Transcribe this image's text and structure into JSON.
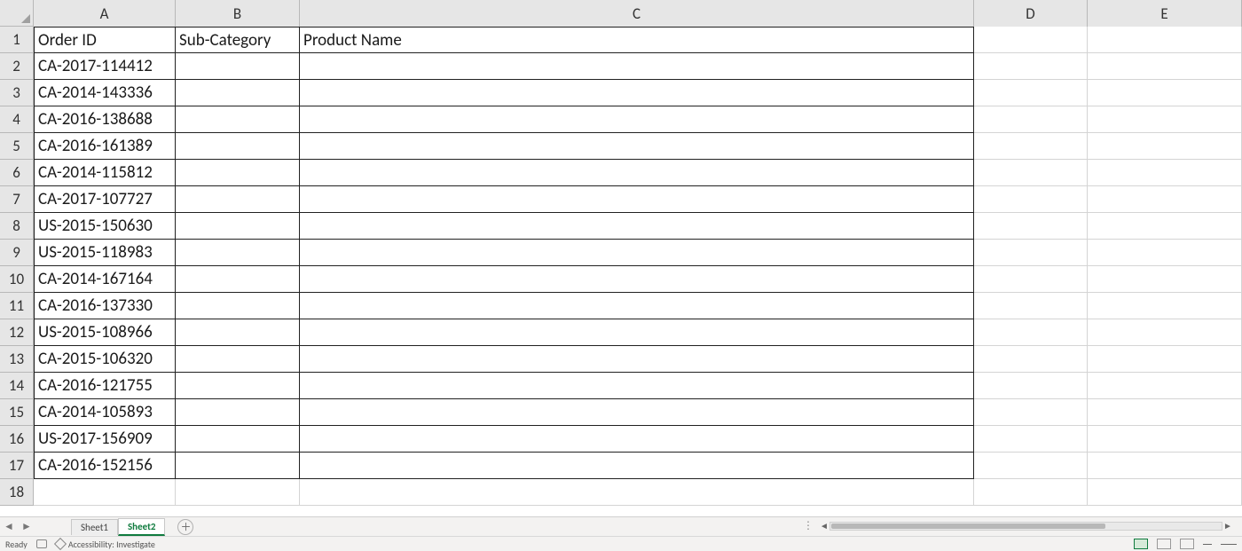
{
  "columns": [
    "A",
    "B",
    "C",
    "D",
    "E"
  ],
  "header_cells": {
    "A": "Order ID",
    "B": "Sub-Category",
    "C": "Product Name"
  },
  "data_rows": [
    "CA-2017-114412",
    "CA-2014-143336",
    "CA-2016-138688",
    "CA-2016-161389",
    "CA-2014-115812",
    "CA-2017-107727",
    "US-2015-150630",
    "US-2015-118983",
    "CA-2014-167164",
    "CA-2016-137330",
    "US-2015-108966",
    "CA-2015-106320",
    "CA-2016-121755",
    "CA-2014-105893",
    "US-2017-156909",
    "CA-2016-152156"
  ],
  "empty_trailing_row": 18,
  "sheets": {
    "inactive": "Sheet1",
    "active": "Sheet2"
  },
  "status": {
    "ready": "Ready",
    "accessibility": "Accessibility: Investigate"
  }
}
